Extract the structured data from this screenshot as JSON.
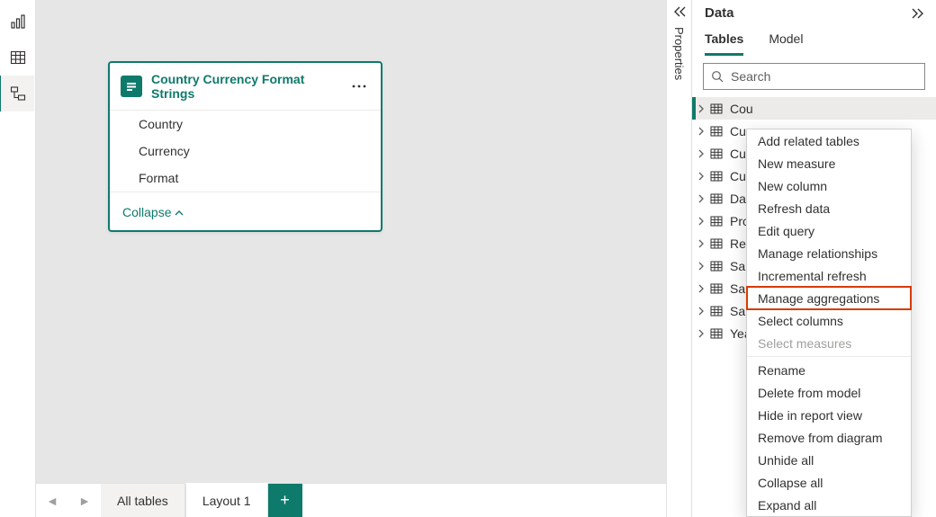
{
  "rail": {
    "items": [
      {
        "name": "report-view",
        "active": false
      },
      {
        "name": "data-view",
        "active": false
      },
      {
        "name": "model-view",
        "active": true
      }
    ]
  },
  "canvas": {
    "card": {
      "title": "Country Currency Format Strings",
      "fields": [
        "Country",
        "Currency",
        "Format"
      ],
      "collapse_label": "Collapse"
    }
  },
  "properties_panel": {
    "label": "Properties"
  },
  "data_panel": {
    "title": "Data",
    "tabs": [
      {
        "label": "Tables",
        "active": true
      },
      {
        "label": "Model",
        "active": false
      }
    ],
    "search_placeholder": "Search",
    "tables": [
      {
        "label": "Cou",
        "selected": true
      },
      {
        "label": "Cur",
        "selected": false
      },
      {
        "label": "Cur",
        "selected": false
      },
      {
        "label": "Cus",
        "selected": false
      },
      {
        "label": "Dat",
        "selected": false
      },
      {
        "label": "Pro",
        "selected": false
      },
      {
        "label": "Res",
        "selected": false
      },
      {
        "label": "Sal",
        "selected": false
      },
      {
        "label": "Sal",
        "selected": false
      },
      {
        "label": "Sal",
        "selected": false
      },
      {
        "label": "Yea",
        "selected": false
      }
    ]
  },
  "context_menu": {
    "items": [
      {
        "label": "Add related tables",
        "type": "item"
      },
      {
        "label": "New measure",
        "type": "item"
      },
      {
        "label": "New column",
        "type": "item"
      },
      {
        "label": "Refresh data",
        "type": "item"
      },
      {
        "label": "Edit query",
        "type": "item"
      },
      {
        "label": "Manage relationships",
        "type": "item"
      },
      {
        "label": "Incremental refresh",
        "type": "item"
      },
      {
        "label": "Manage aggregations",
        "type": "item",
        "highlight": true
      },
      {
        "label": "Select columns",
        "type": "item"
      },
      {
        "label": "Select measures",
        "type": "item",
        "disabled": true
      },
      {
        "type": "sep"
      },
      {
        "label": "Rename",
        "type": "item"
      },
      {
        "label": "Delete from model",
        "type": "item"
      },
      {
        "label": "Hide in report view",
        "type": "item"
      },
      {
        "label": "Remove from diagram",
        "type": "item"
      },
      {
        "label": "Unhide all",
        "type": "item"
      },
      {
        "label": "Collapse all",
        "type": "item"
      },
      {
        "label": "Expand all",
        "type": "item"
      }
    ]
  },
  "layout_bar": {
    "tabs": [
      {
        "label": "All tables",
        "active": false
      },
      {
        "label": "Layout 1",
        "active": true
      }
    ]
  }
}
